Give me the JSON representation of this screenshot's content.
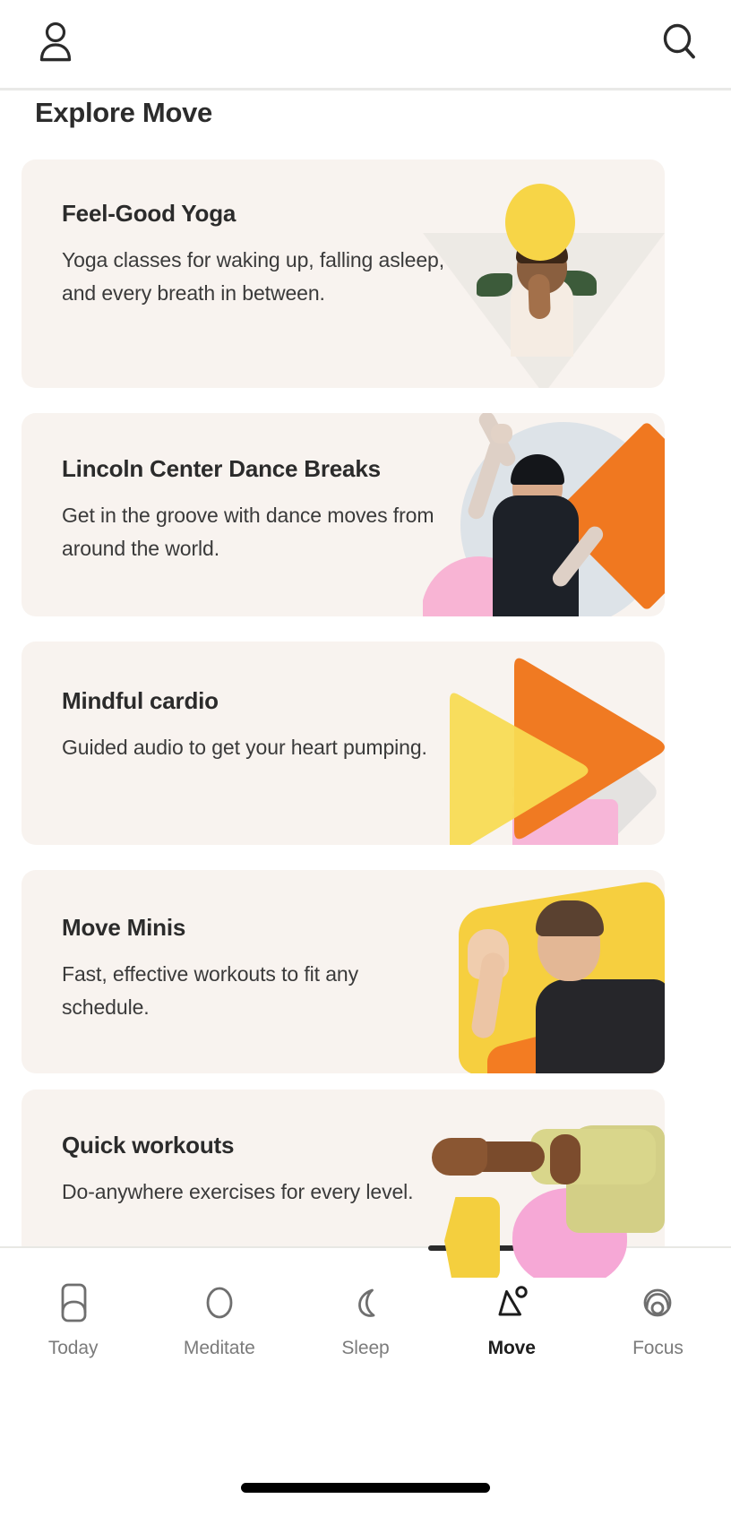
{
  "header": {
    "profile_icon": "person-icon",
    "search_icon": "search-icon"
  },
  "page_title": "Explore Move",
  "cards": [
    {
      "title": "Feel-Good Yoga",
      "description": "Yoga classes for waking up, falling asleep, and every breath in between.",
      "art": "yoga-photo-yellow-circle"
    },
    {
      "title": "Lincoln Center Dance Breaks",
      "description": "Get in the groove with dance moves from around the world.",
      "art": "dancer-photo-orange-diamond"
    },
    {
      "title": "Mindful cardio",
      "description": "Guided audio to get your heart pumping.",
      "art": "play-triangles-yellow-orange"
    },
    {
      "title": "Move Minis",
      "description": "Fast, effective workouts to fit any schedule.",
      "art": "man-waving-yellow-shape"
    },
    {
      "title": "Quick workouts",
      "description": "Do-anywhere exercises for every level.",
      "art": "arms-stretching-pink-yellow"
    }
  ],
  "tabbar": {
    "active": "Move",
    "items": [
      {
        "label": "Today",
        "icon": "today-card-icon"
      },
      {
        "label": "Meditate",
        "icon": "circle-icon"
      },
      {
        "label": "Sleep",
        "icon": "moon-icon"
      },
      {
        "label": "Move",
        "icon": "triangle-dot-icon"
      },
      {
        "label": "Focus",
        "icon": "spiral-icon"
      }
    ]
  },
  "colors": {
    "card_bg": "#f8f3ef",
    "accent_yellow": "#f7d547",
    "accent_orange": "#f07820",
    "accent_pink": "#f8b4d4",
    "text_dark": "#2b2b2b",
    "tab_inactive": "#7b7b7b"
  }
}
